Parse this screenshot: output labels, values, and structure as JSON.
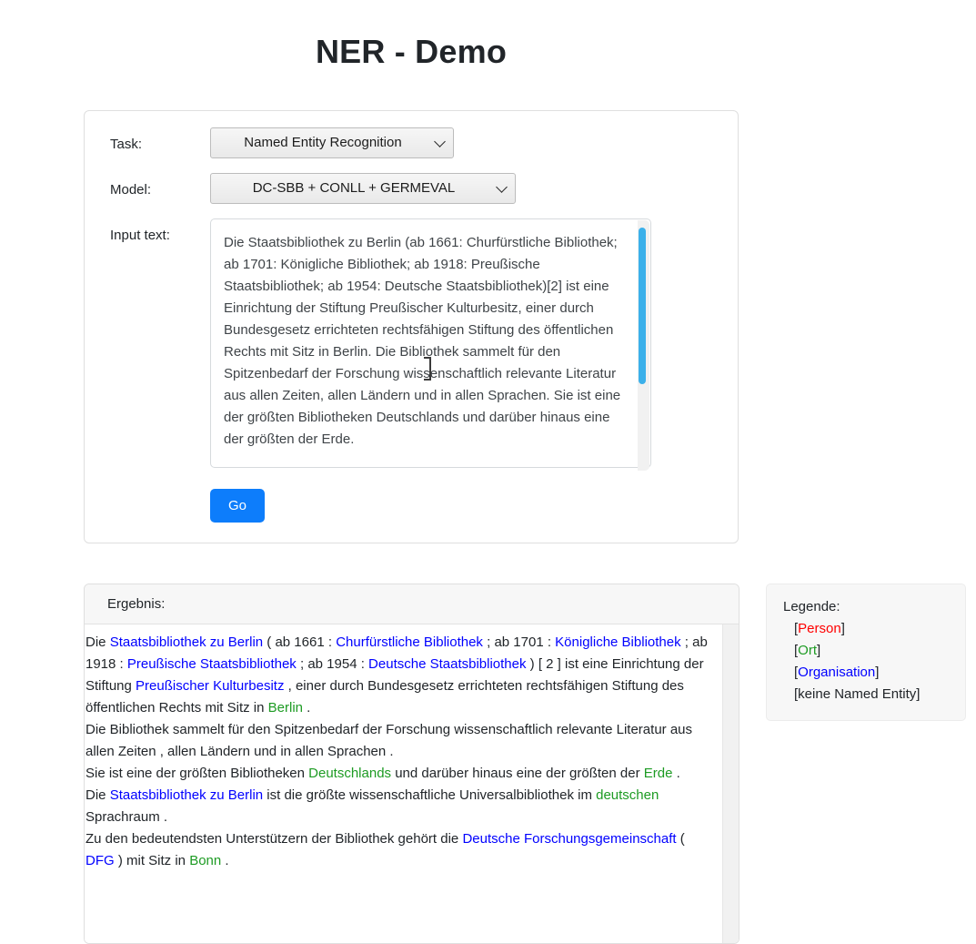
{
  "page": {
    "title": "NER - Demo"
  },
  "form": {
    "task": {
      "label": "Task:",
      "selected": "Named Entity Recognition",
      "options": [
        "Named Entity Recognition"
      ]
    },
    "model": {
      "label": "Model:",
      "selected": "DC-SBB + CONLL + GERMEVAL",
      "options": [
        "DC-SBB + CONLL + GERMEVAL"
      ]
    },
    "input_text": {
      "label": "Input text:",
      "value": "Die Staatsbibliothek zu Berlin (ab 1661: Churfürstliche Bibliothek; ab 1701: Königliche Bibliothek; ab 1918: Preußische Staatsbibliothek; ab 1954: Deutsche Staatsbibliothek)[2] ist eine Einrichtung der Stiftung Preußischer Kulturbesitz, einer durch Bundesgesetz errichteten rechtsfähigen Stiftung des öffentlichen Rechts mit Sitz in Berlin. Die Bibliothek sammelt für den Spitzenbedarf der Forschung wissenschaftlich relevante Literatur aus allen Zeiten, allen Ländern und in allen Sprachen. Sie ist eine der größten Bibliotheken Deutschlands und darüber hinaus eine der größten der Erde."
    },
    "submit": {
      "label": "Go"
    }
  },
  "result": {
    "header": "Ergebnis:",
    "lines": [
      [
        {
          "t": "Die ",
          "k": "none"
        },
        {
          "t": "Staatsbibliothek zu Berlin",
          "k": "org"
        },
        {
          "t": " ( ab 1661 : ",
          "k": "none"
        },
        {
          "t": "Churfürstliche Bibliothek",
          "k": "org"
        },
        {
          "t": " ; ab 1701 : ",
          "k": "none"
        },
        {
          "t": "Königliche Bibliothek",
          "k": "org"
        },
        {
          "t": " ; ab 1918 : ",
          "k": "none"
        },
        {
          "t": "Preußische Staatsbibliothek",
          "k": "org"
        },
        {
          "t": " ; ab 1954 : ",
          "k": "none"
        },
        {
          "t": "Deutsche Staatsbibliothek",
          "k": "org"
        },
        {
          "t": " ) [ 2 ] ist eine Einrichtung der Stiftung ",
          "k": "none"
        },
        {
          "t": "Preußischer Kulturbesitz",
          "k": "org"
        },
        {
          "t": " , einer durch Bundesgesetz errichteten rechtsfähigen Stiftung des öffentlichen Rechts mit Sitz in ",
          "k": "none"
        },
        {
          "t": "Berlin",
          "k": "loc"
        },
        {
          "t": " .",
          "k": "none"
        }
      ],
      [
        {
          "t": "Die Bibliothek sammelt für den Spitzenbedarf der Forschung wissenschaftlich relevante Literatur aus allen Zeiten , allen Ländern und in allen Sprachen .",
          "k": "none"
        }
      ],
      [
        {
          "t": "Sie ist eine der größten Bibliotheken ",
          "k": "none"
        },
        {
          "t": "Deutschlands",
          "k": "loc"
        },
        {
          "t": " und darüber hinaus eine der größten der ",
          "k": "none"
        },
        {
          "t": "Erde",
          "k": "loc"
        },
        {
          "t": " .",
          "k": "none"
        }
      ],
      [
        {
          "t": "Die ",
          "k": "none"
        },
        {
          "t": "Staatsbibliothek zu Berlin",
          "k": "org"
        },
        {
          "t": " ist die größte wissenschaftliche Universalbibliothek im ",
          "k": "none"
        },
        {
          "t": "deutschen",
          "k": "loc"
        },
        {
          "t": " Sprachraum .",
          "k": "none"
        }
      ],
      [
        {
          "t": "Zu den bedeutendsten Unterstützern der Bibliothek gehört die ",
          "k": "none"
        },
        {
          "t": "Deutsche Forschungsgemeinschaft",
          "k": "org"
        },
        {
          "t": " ( ",
          "k": "none"
        },
        {
          "t": "DFG",
          "k": "org"
        },
        {
          "t": " ) mit Sitz in ",
          "k": "none"
        },
        {
          "t": "Bonn",
          "k": "loc"
        },
        {
          "t": " .",
          "k": "none"
        }
      ]
    ]
  },
  "legend": {
    "title": "Legende:",
    "items": [
      {
        "open": "[",
        "label": "Person",
        "close": "]",
        "kind": "per"
      },
      {
        "open": "[",
        "label": "Ort",
        "close": "]",
        "kind": "loc"
      },
      {
        "open": "[",
        "label": "Organisation",
        "close": "]",
        "kind": "org"
      },
      {
        "open": "[",
        "label": "keine Named Entity",
        "close": "]",
        "kind": "none"
      }
    ]
  },
  "colors": {
    "person": "#ff0000",
    "ort": "#1d9b23",
    "organisation": "#0000ff",
    "accent_button": "#0d7dfb",
    "scrollbar_thumb": "#3bb0ea"
  }
}
